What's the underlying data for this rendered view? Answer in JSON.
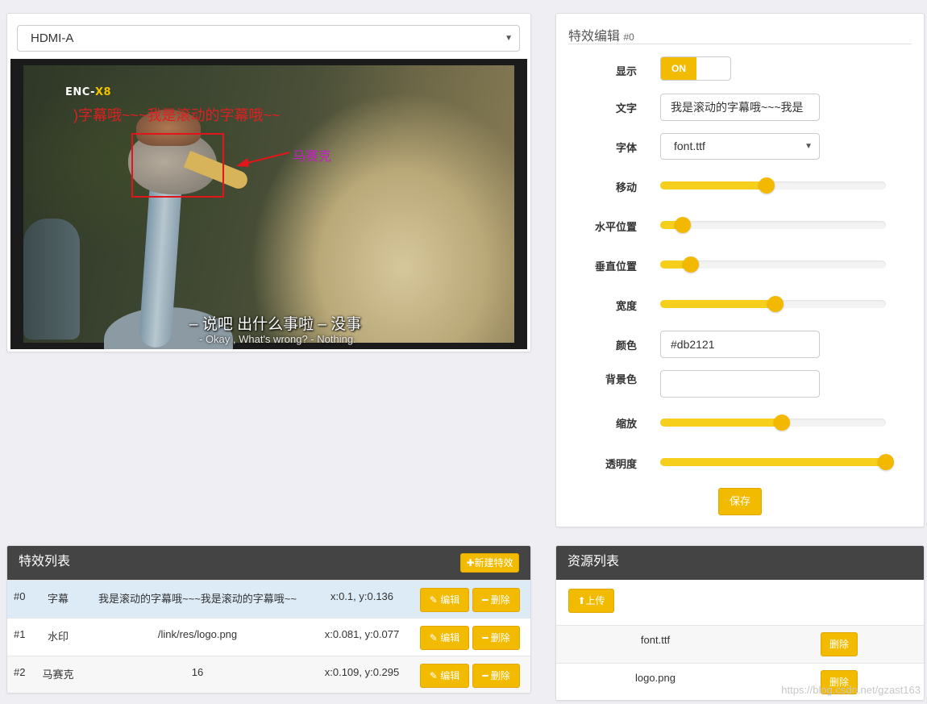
{
  "video": {
    "source_select": "HDMI-A",
    "overlay_logo": {
      "prefix": "ENC-",
      "suffix": "X8"
    },
    "overlay_scroll_text": ")字幕哦~~~我是滚动的字幕哦~~",
    "mosaic_label": "马赛克",
    "subtitle_cn": "– 说吧 出什么事啦 – 没事",
    "subtitle_en": "- Okay , What's wrong? - Nothing."
  },
  "editor": {
    "title": "特效编辑",
    "index": "#0",
    "show_label": "显示",
    "show_toggle": "ON",
    "text_label": "文字",
    "text_value": "我是滚动的字幕哦~~~我是",
    "font_label": "字体",
    "font_value": "font.ttf",
    "move_label": "移动",
    "move_value": 0.47,
    "hpos_label": "水平位置",
    "hpos_value": 0.1,
    "vpos_label": "垂直位置",
    "vpos_value": 0.136,
    "width_label": "宽度",
    "width_value": 0.51,
    "color_label": "颜色",
    "color_value": "#db2121",
    "bgcolor_label": "背景色",
    "bgcolor_value": "",
    "scale_label": "缩放",
    "scale_value": 0.54,
    "opacity_label": "透明度",
    "opacity_value": 1.0,
    "save_button": "保存"
  },
  "effects": {
    "title": "特效列表",
    "new_button": "新建特效",
    "edit_button": "编辑",
    "delete_button": "删除",
    "rows": [
      {
        "id": "#0",
        "type": "字幕",
        "content": "我是滚动的字幕哦~~~我是滚动的字幕哦~~",
        "position": "x:0.1, y:0.136"
      },
      {
        "id": "#1",
        "type": "水印",
        "content": "/link/res/logo.png",
        "position": "x:0.081, y:0.077"
      },
      {
        "id": "#2",
        "type": "马赛克",
        "content": "16",
        "position": "x:0.109, y:0.295"
      }
    ]
  },
  "resources": {
    "title": "资源列表",
    "upload_button": "上传",
    "delete_button": "删除",
    "rows": [
      {
        "name": "font.ttf"
      },
      {
        "name": "logo.png"
      }
    ]
  },
  "watermark": "https://blog.csdn.net/gzast163",
  "colors": {
    "accent": "#f3bb00",
    "header": "#444444",
    "selected_row": "#dcebf6",
    "striped_row": "#f7f7f7"
  }
}
